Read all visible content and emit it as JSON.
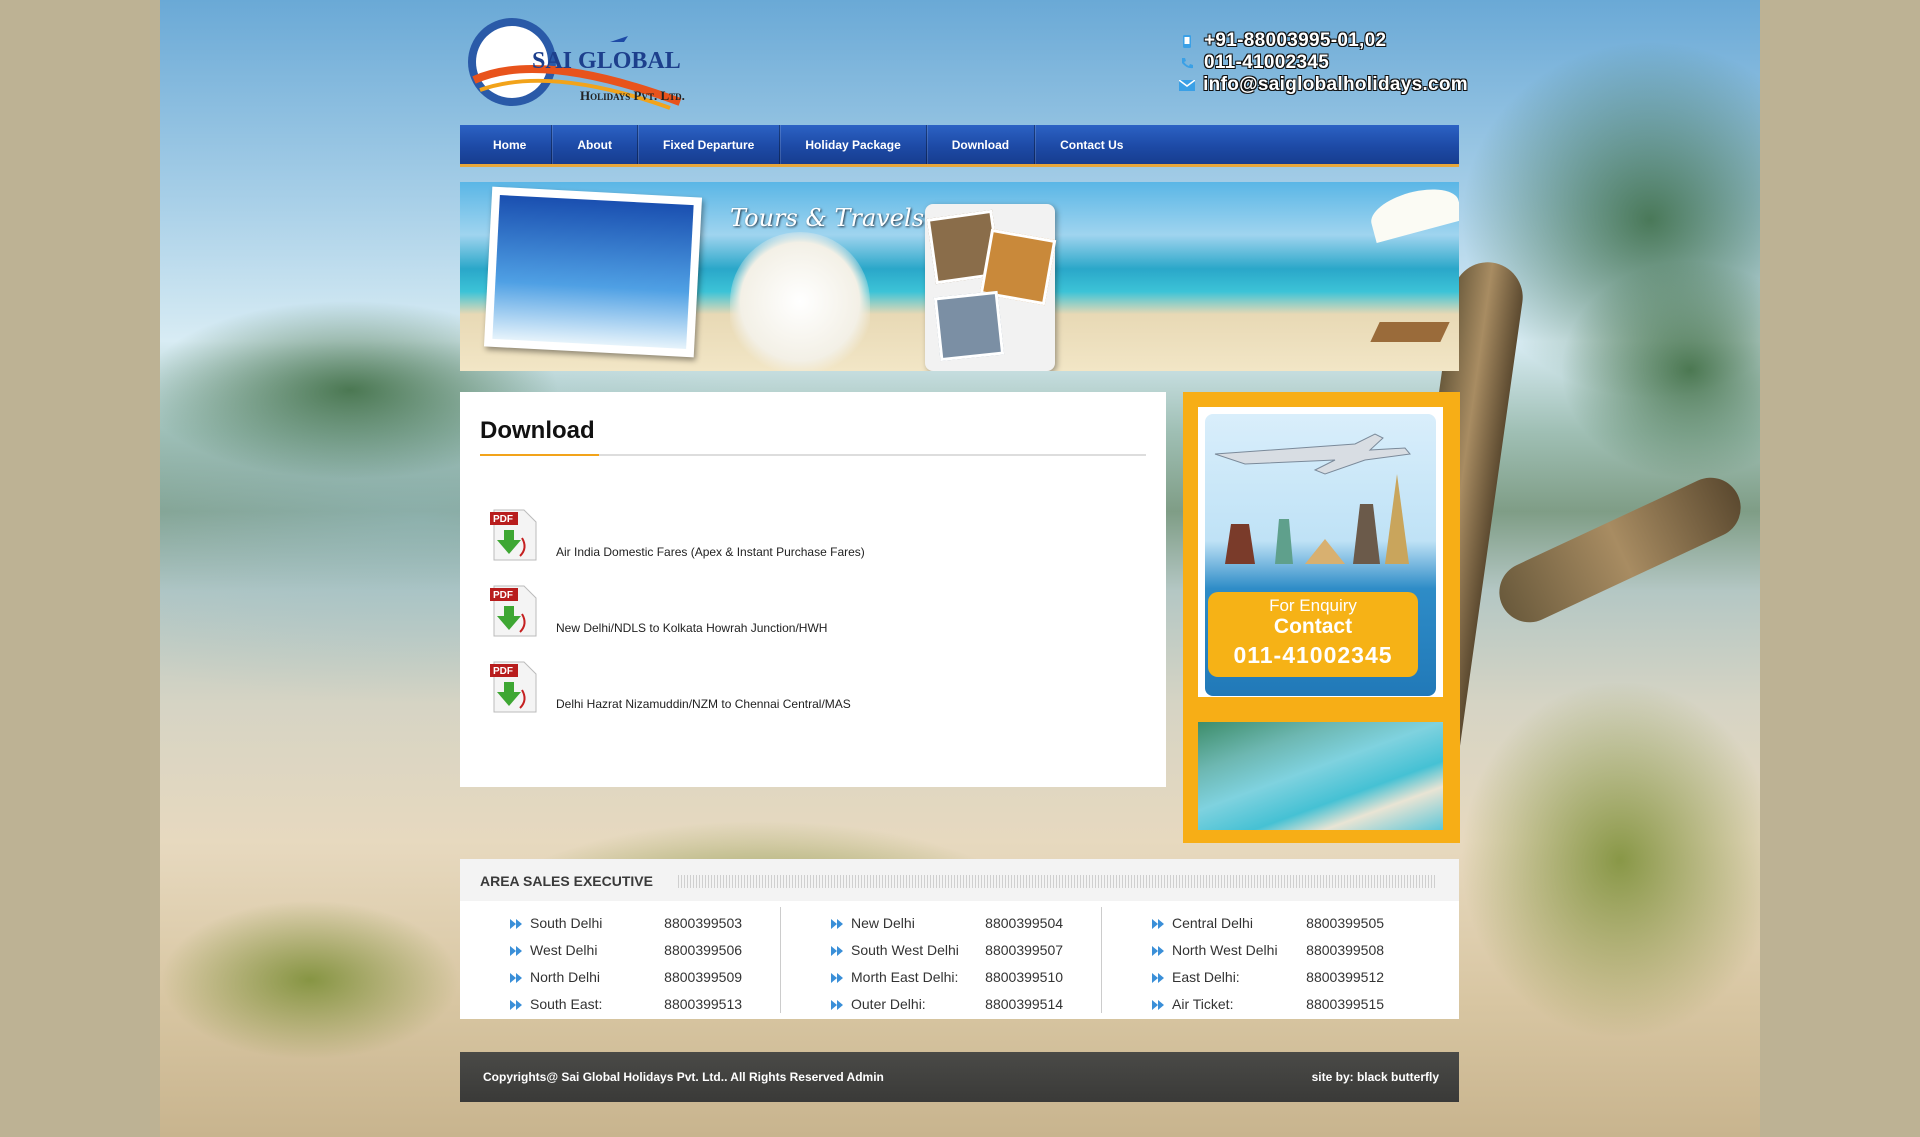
{
  "header": {
    "logo_brand": "SAI GLOBAL",
    "logo_sub": "Holidays Pvt. Ltd.",
    "contacts": [
      {
        "icon": "mobile-icon",
        "text": "+91-88003995-01,02"
      },
      {
        "icon": "phone-icon",
        "text": "011-41002345"
      },
      {
        "icon": "mail-icon",
        "text": "info@saiglobalholidays.com"
      }
    ]
  },
  "nav": {
    "items": [
      "Home",
      "About",
      "Fixed Departure",
      "Holiday Package",
      "Download",
      "Contact Us"
    ]
  },
  "banner": {
    "caption": "Tours & Travels"
  },
  "content": {
    "title": "Download",
    "downloads": [
      {
        "icon": "pdf-download-icon",
        "label": "Air India Domestic Fares (Apex & Instant Purchase Fares)"
      },
      {
        "icon": "pdf-download-icon",
        "label": "New Delhi/NDLS to Kolkata Howrah Junction/HWH"
      },
      {
        "icon": "pdf-download-icon",
        "label": "Delhi Hazrat Nizamuddin/NZM to Chennai Central/MAS"
      }
    ]
  },
  "sidebar": {
    "enquiry_line1": "For Enquiry",
    "enquiry_line2": "Contact",
    "enquiry_phone": "011-41002345"
  },
  "area_sales": {
    "title": "AREA SALES EXECUTIVE",
    "columns": [
      [
        {
          "name": "South Delhi",
          "number": "8800399503"
        },
        {
          "name": "West Delhi",
          "number": "8800399506"
        },
        {
          "name": "North Delhi",
          "number": "8800399509"
        },
        {
          "name": "South East:",
          "number": "8800399513"
        }
      ],
      [
        {
          "name": "New Delhi",
          "number": "8800399504"
        },
        {
          "name": "South West Delhi",
          "number": "8800399507"
        },
        {
          "name": "Morth East Delhi:",
          "number": "8800399510"
        },
        {
          "name": "Outer Delhi:",
          "number": "8800399514"
        }
      ],
      [
        {
          "name": "Central Delhi",
          "number": "8800399505"
        },
        {
          "name": "North West Delhi",
          "number": "8800399508"
        },
        {
          "name": "East Delhi:",
          "number": "8800399512"
        },
        {
          "name": "Air Ticket:",
          "number": "8800399515"
        }
      ]
    ]
  },
  "footer": {
    "copyright": "Copyrights@ Sai Global Holidays Pvt. Ltd.. All Rights Reserved Admin",
    "credit": "site by: black butterfly"
  },
  "colors": {
    "nav_blue": "#1d4aa6",
    "accent_orange": "#f7ae16",
    "footer_dark": "#3a3a38"
  }
}
